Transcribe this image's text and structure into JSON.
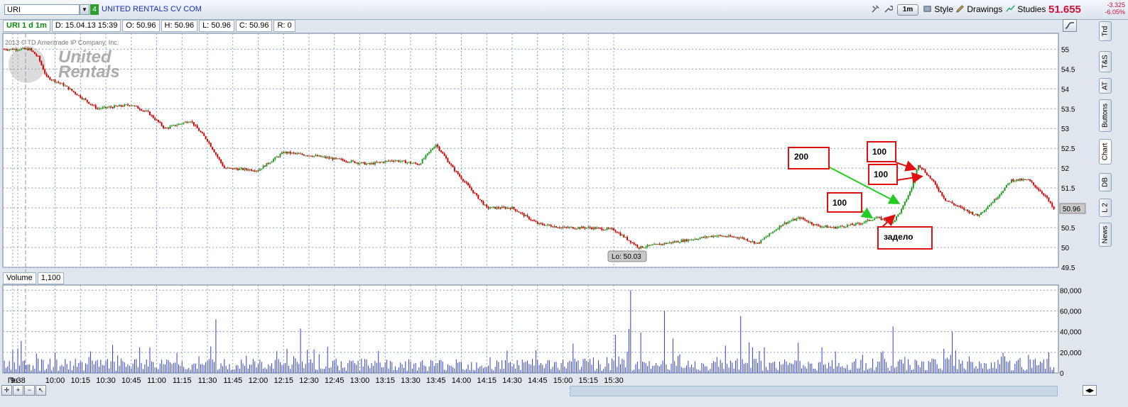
{
  "toolbar": {
    "symbol": "URI",
    "link_badge": "4",
    "company": "UNITED RENTALS CV COM",
    "period": "1m",
    "style_label": "Style",
    "drawings_label": "Drawings",
    "studies_label": "Studies",
    "last_price": "51.655",
    "change": "-3.325",
    "change_pct": "-6.05%"
  },
  "infobar": {
    "title": "URI 1 d 1m",
    "date": "D: 15.04.13 15:39",
    "open": "O: 50.96",
    "high": "H: 50.96",
    "low": "L: 50.96",
    "close": "C: 50.96",
    "range": "R: 0"
  },
  "watermark": {
    "copyright": "2013 © TD Ameritrade IP Company, Inc.",
    "logo_line1": "United",
    "logo_line2": "Rentals"
  },
  "side_tabs": [
    "Trd",
    "T&S",
    "AT",
    "Buttons",
    "Chart",
    "DB",
    "L 2",
    "News"
  ],
  "volume_header": {
    "label": "Volume",
    "value": "1,100"
  },
  "annotations": {
    "box_200": "200",
    "box_100_a": "100",
    "box_100_b": "100",
    "box_100_c": "100",
    "box_zadelo": "задело",
    "low_label": "Lo: 50.03",
    "price_tag": "50.96"
  },
  "chart_data": {
    "type": "candlestick",
    "price_axis": {
      "ticks": [
        "55",
        "54.5",
        "54",
        "53.5",
        "53",
        "52.5",
        "52",
        "51.5",
        "51",
        "50.5",
        "50",
        "49.5"
      ],
      "ylim": [
        49.5,
        55.4
      ]
    },
    "volume_axis": {
      "ticks": [
        "80,000",
        "60,000",
        "40,000",
        "20,000",
        "0"
      ],
      "ylim": [
        0,
        85000
      ]
    },
    "x_ticks": [
      "Пн",
      "9:38",
      "10:00",
      "10:15",
      "10:30",
      "10:45",
      "11:00",
      "11:15",
      "11:30",
      "11:45",
      "12:00",
      "12:15",
      "12:30",
      "12:45",
      "13:00",
      "13:15",
      "13:30",
      "13:45",
      "14:00",
      "14:15",
      "14:30",
      "14:45",
      "15:00",
      "15:15",
      "15:30"
    ],
    "price_path": [
      [
        0,
        55.0
      ],
      [
        15,
        55.0
      ],
      [
        20,
        54.8
      ],
      [
        25,
        54.3
      ],
      [
        35,
        54.1
      ],
      [
        45,
        53.8
      ],
      [
        55,
        53.5
      ],
      [
        75,
        53.6
      ],
      [
        85,
        53.4
      ],
      [
        95,
        53.0
      ],
      [
        110,
        53.2
      ],
      [
        120,
        52.7
      ],
      [
        130,
        52.0
      ],
      [
        150,
        51.95
      ],
      [
        165,
        52.4
      ],
      [
        185,
        52.3
      ],
      [
        200,
        52.2
      ],
      [
        215,
        52.1
      ],
      [
        230,
        52.2
      ],
      [
        245,
        52.1
      ],
      [
        255,
        52.6
      ],
      [
        265,
        52.0
      ],
      [
        275,
        51.5
      ],
      [
        285,
        51.0
      ],
      [
        300,
        51.0
      ],
      [
        315,
        50.6
      ],
      [
        330,
        50.5
      ],
      [
        345,
        50.5
      ],
      [
        360,
        50.45
      ],
      [
        375,
        50.0
      ],
      [
        390,
        50.1
      ],
      [
        405,
        50.2
      ],
      [
        420,
        50.3
      ],
      [
        435,
        50.25
      ],
      [
        445,
        50.1
      ],
      [
        460,
        50.6
      ],
      [
        470,
        50.75
      ],
      [
        480,
        50.55
      ],
      [
        490,
        50.5
      ],
      [
        505,
        50.6
      ],
      [
        515,
        50.75
      ],
      [
        525,
        50.65
      ],
      [
        530,
        50.95
      ],
      [
        536,
        51.5
      ],
      [
        540,
        52.1
      ],
      [
        548,
        51.7
      ],
      [
        556,
        51.2
      ],
      [
        565,
        51.0
      ],
      [
        575,
        50.8
      ],
      [
        585,
        51.2
      ],
      [
        595,
        51.7
      ],
      [
        605,
        51.7
      ],
      [
        615,
        51.3
      ],
      [
        620,
        50.96
      ]
    ],
    "volume_peaks": [
      [
        125,
        52000
      ],
      [
        175,
        43000
      ],
      [
        370,
        80000
      ],
      [
        390,
        60000
      ],
      [
        435,
        55000
      ],
      [
        525,
        45000
      ],
      [
        560,
        40000
      ]
    ]
  }
}
